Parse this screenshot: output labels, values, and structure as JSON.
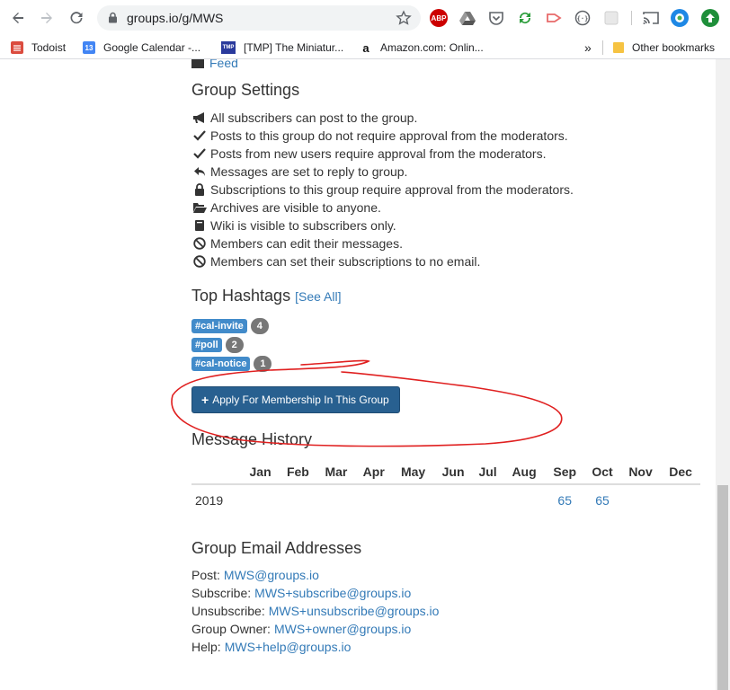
{
  "browser": {
    "url": "groups.io/g/MWS",
    "extensions": [
      "abp-icon",
      "drive-icon",
      "pocket-icon",
      "sync-icon",
      "arrow-icon",
      "code-icon",
      "blank-icon",
      "cast-icon",
      "lens-icon",
      "up-icon"
    ],
    "abp_label": "ABP"
  },
  "bookmarks": {
    "items": [
      {
        "label": "Todoist",
        "icon": "todoist-icon",
        "color": "#db4c3f"
      },
      {
        "label": "Google Calendar -...",
        "icon": "calendar-icon",
        "color": "#4285f4",
        "badge": "13"
      },
      {
        "label": "[TMP] The Miniatur...",
        "icon": "tmp-icon",
        "color": "#2a3a9c",
        "badge": "TMP"
      },
      {
        "label": "Amazon.com: Onlin...",
        "icon": "amazon-icon",
        "color": "#ffffff",
        "badge": "a"
      }
    ],
    "overflow": "»",
    "other": "Other bookmarks"
  },
  "page": {
    "feed_link": "Feed",
    "settings_title": "Group Settings",
    "settings": [
      {
        "icon": "megaphone-icon",
        "text": "All subscribers can post to the group."
      },
      {
        "icon": "check-icon",
        "text": "Posts to this group do not require approval from the moderators."
      },
      {
        "icon": "check-icon",
        "text": "Posts from new users require approval from the moderators."
      },
      {
        "icon": "reply-icon",
        "text": "Messages are set to reply to group."
      },
      {
        "icon": "lock-icon",
        "text": "Subscriptions to this group require approval from the moderators."
      },
      {
        "icon": "folder-open-icon",
        "text": "Archives are visible to anyone."
      },
      {
        "icon": "book-icon",
        "text": "Wiki is visible to subscribers only."
      },
      {
        "icon": "ban-icon",
        "text": "Members can edit their messages."
      },
      {
        "icon": "ban-icon",
        "text": "Members can set their subscriptions to no email."
      }
    ],
    "hashtags_title": "Top Hashtags",
    "see_all": "[See All]",
    "hashtags": [
      {
        "tag": "#cal-invite",
        "count": "4"
      },
      {
        "tag": "#poll",
        "count": "2"
      },
      {
        "tag": "#cal-notice",
        "count": "1"
      }
    ],
    "apply_button": "Apply For Membership In This Group",
    "history_title": "Message History",
    "months": [
      "Jan",
      "Feb",
      "Mar",
      "Apr",
      "May",
      "Jun",
      "Jul",
      "Aug",
      "Sep",
      "Oct",
      "Nov",
      "Dec"
    ],
    "history_rows": [
      {
        "year": "2019",
        "values": [
          "",
          "",
          "",
          "",
          "",
          "",
          "",
          "",
          "65",
          "65",
          "",
          ""
        ]
      }
    ],
    "email_title": "Group Email Addresses",
    "emails": [
      {
        "label": "Post:",
        "address": "MWS@groups.io"
      },
      {
        "label": "Subscribe:",
        "address": "MWS+subscribe@groups.io"
      },
      {
        "label": "Unsubscribe:",
        "address": "MWS+unsubscribe@groups.io"
      },
      {
        "label": "Group Owner:",
        "address": "MWS+owner@groups.io"
      },
      {
        "label": "Help:",
        "address": "MWS+help@groups.io"
      }
    ]
  },
  "colors": {
    "link": "#337ab7",
    "button": "#286090",
    "tag": "#428bca",
    "badge": "#777777",
    "annotation": "#e02020"
  }
}
